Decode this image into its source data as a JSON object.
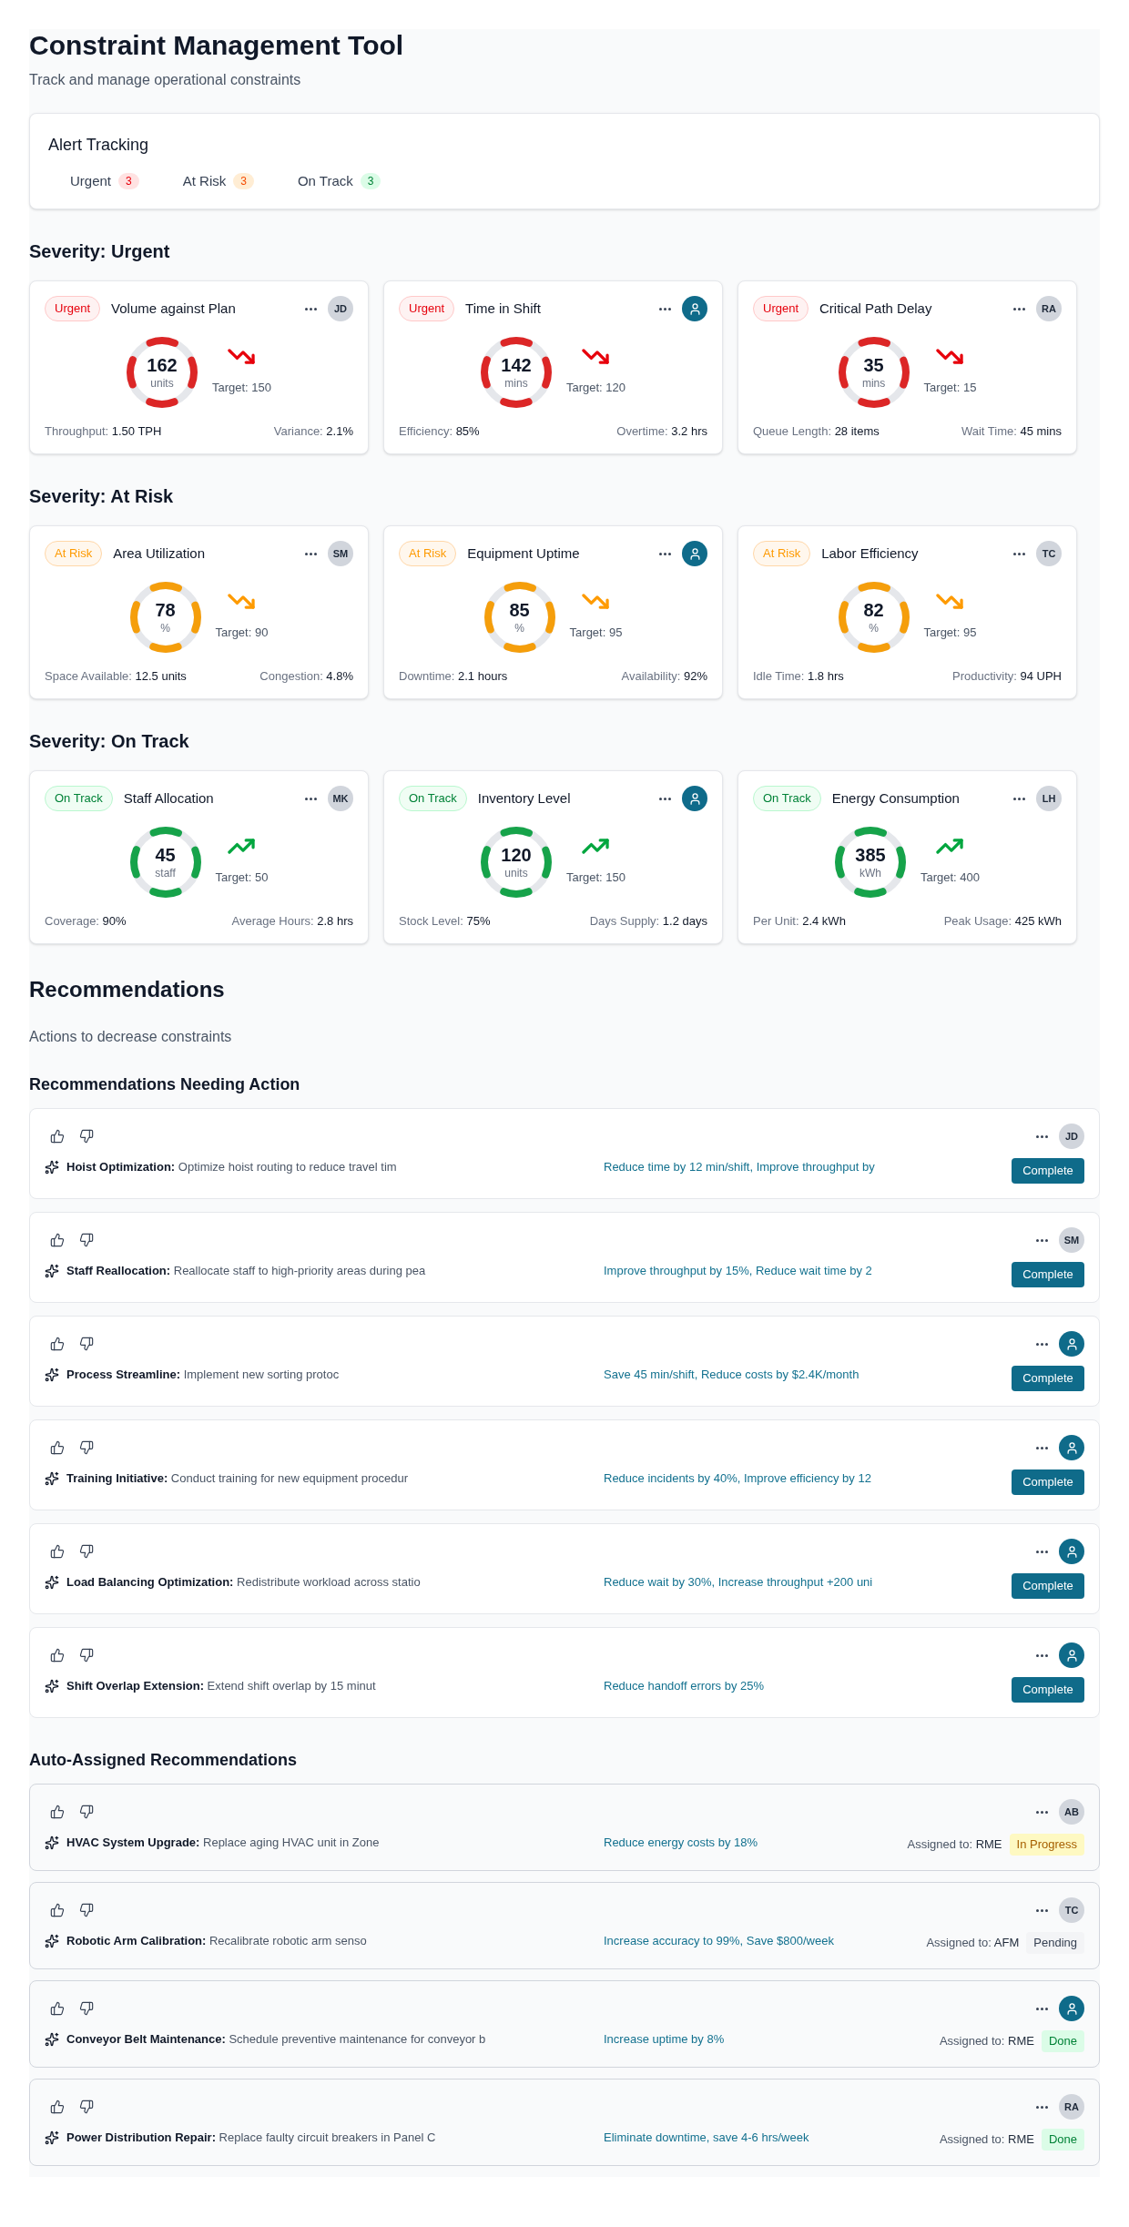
{
  "header": {
    "title": "Constraint Management Tool",
    "subtitle": "Track and manage operational constraints"
  },
  "alert_tracking": {
    "title": "Alert Tracking",
    "items": [
      {
        "label": "Urgent",
        "count": "3",
        "kind": "urgent"
      },
      {
        "label": "At Risk",
        "count": "3",
        "kind": "at_risk"
      },
      {
        "label": "On Track",
        "count": "3",
        "kind": "on_track"
      }
    ]
  },
  "severity_sections": [
    {
      "heading": "Severity: Urgent",
      "kind": "urgent",
      "cards": [
        {
          "badge": "Urgent",
          "title": "Volume against Plan",
          "avatar": {
            "kind": "initials",
            "text": "JD"
          },
          "value": "162",
          "unit": "units",
          "rising": false,
          "target": "Target: 150",
          "metrics": [
            "Throughput: **1.50 TPH**",
            "Variance: **2.1%**"
          ]
        },
        {
          "badge": "Urgent",
          "title": "Time in Shift",
          "avatar": {
            "kind": "user"
          },
          "value": "142",
          "unit": "mins",
          "rising": false,
          "target": "Target: 120",
          "metrics": [
            "Efficiency: **85%**",
            "Overtime: **3.2 hrs**"
          ]
        },
        {
          "badge": "Urgent",
          "title": "Critical Path Delay",
          "avatar": {
            "kind": "initials",
            "text": "RA"
          },
          "value": "35",
          "unit": "mins",
          "rising": false,
          "target": "Target: 15",
          "metrics": [
            "Queue Length: **28 items**",
            "Wait Time: **45 mins**"
          ]
        }
      ]
    },
    {
      "heading": "Severity: At Risk",
      "kind": "at_risk",
      "cards": [
        {
          "badge": "At Risk",
          "title": "Area Utilization",
          "avatar": {
            "kind": "initials",
            "text": "SM"
          },
          "value": "78",
          "unit": "%",
          "rising": false,
          "target": "Target: 90",
          "metrics": [
            "Space Available: **12.5 units**",
            "Congestion: **4.8%**"
          ]
        },
        {
          "badge": "At Risk",
          "title": "Equipment Uptime",
          "avatar": {
            "kind": "user"
          },
          "value": "85",
          "unit": "%",
          "rising": false,
          "target": "Target: 95",
          "metrics": [
            "Downtime: **2.1 hours**",
            "Availability: **92%**"
          ]
        },
        {
          "badge": "At Risk",
          "title": "Labor Efficiency",
          "avatar": {
            "kind": "initials",
            "text": "TC"
          },
          "value": "82",
          "unit": "%",
          "rising": false,
          "target": "Target: 95",
          "metrics": [
            "Idle Time: **1.8 hrs**",
            "Productivity: **94 UPH**"
          ]
        }
      ]
    },
    {
      "heading": "Severity: On Track",
      "kind": "on_track",
      "cards": [
        {
          "badge": "On Track",
          "title": "Staff Allocation",
          "avatar": {
            "kind": "initials",
            "text": "MK"
          },
          "value": "45",
          "unit": "staff",
          "rising": true,
          "target": "Target: 50",
          "metrics": [
            "Coverage: **90%**",
            "Average Hours: **2.8 hrs**"
          ]
        },
        {
          "badge": "On Track",
          "title": "Inventory Level",
          "avatar": {
            "kind": "user"
          },
          "value": "120",
          "unit": "units",
          "rising": true,
          "target": "Target: 150",
          "metrics": [
            "Stock Level: **75%**",
            "Days Supply: **1.2 days**"
          ]
        },
        {
          "badge": "On Track",
          "title": "Energy Consumption",
          "avatar": {
            "kind": "initials",
            "text": "LH"
          },
          "value": "385",
          "unit": "kWh",
          "rising": true,
          "target": "Target: 400",
          "metrics": [
            "Per Unit: **2.4 kWh**",
            "Peak Usage: **425 kWh**"
          ]
        }
      ]
    }
  ],
  "recommendations": {
    "title": "Recommendations",
    "subtitle": "Actions to decrease constraints",
    "groups": [
      {
        "heading": "Recommendations Needing Action",
        "kind": "action",
        "items": [
          {
            "text": "**Hoist Optimization:** Optimize hoist routing to reduce travel tim",
            "impact": "Reduce time by 12 min/shift, Improve throughput by",
            "avatar": {
              "kind": "initials",
              "text": "JD"
            },
            "button": "Complete"
          },
          {
            "text": "**Staff Reallocation:** Reallocate staff to high-priority areas during pea",
            "impact": "Improve throughput by 15%, Reduce wait time by 2",
            "avatar": {
              "kind": "initials",
              "text": "SM"
            },
            "button": "Complete"
          },
          {
            "text": "**Process Streamline:** Implement new sorting protoc",
            "impact": "Save 45 min/shift, Reduce costs by $2.4K/month",
            "avatar": {
              "kind": "user"
            },
            "button": "Complete"
          },
          {
            "text": "**Training Initiative:** Conduct training for new equipment procedur",
            "impact": "Reduce incidents by 40%, Improve efficiency by 12",
            "avatar": {
              "kind": "user"
            },
            "button": "Complete"
          },
          {
            "text": "**Load Balancing Optimization:** Redistribute workload across statio",
            "impact": "Reduce wait by 30%, Increase throughput +200 uni",
            "avatar": {
              "kind": "user"
            },
            "button": "Complete"
          },
          {
            "text": "**Shift Overlap Extension:** Extend shift overlap by 15 minut",
            "impact": "Reduce handoff errors by 25%",
            "avatar": {
              "kind": "user"
            },
            "button": "Complete"
          }
        ]
      },
      {
        "heading": "Auto-Assigned Recommendations",
        "kind": "auto",
        "items": [
          {
            "text": "**HVAC System Upgrade:** Replace aging HVAC unit in Zone",
            "impact": "Reduce energy costs by 18%",
            "avatar": {
              "kind": "initials",
              "text": "AB"
            },
            "assigned": "Assigned to: **RME**",
            "status": {
              "label": "In Progress",
              "kind": "in_progress"
            }
          },
          {
            "text": "**Robotic Arm Calibration:** Recalibrate robotic arm senso",
            "impact": "Increase accuracy to 99%, Save $800/week",
            "avatar": {
              "kind": "initials",
              "text": "TC"
            },
            "assigned": "Assigned to: **AFM**",
            "status": {
              "label": "Pending",
              "kind": "pending"
            }
          },
          {
            "text": "**Conveyor Belt Maintenance:** Schedule preventive maintenance for conveyor b",
            "impact": "Increase uptime by 8%",
            "avatar": {
              "kind": "user"
            },
            "assigned": "Assigned to: **RME**",
            "status": {
              "label": "Done",
              "kind": "done"
            }
          },
          {
            "text": "**Power Distribution Repair:** Replace faulty circuit breakers in Panel C",
            "impact": "Eliminate downtime, save 4-6 hrs/week",
            "avatar": {
              "kind": "initials",
              "text": "RA"
            },
            "assigned": "Assigned to: **RME**",
            "status": {
              "label": "Done",
              "kind": "done"
            }
          }
        ]
      }
    ]
  }
}
